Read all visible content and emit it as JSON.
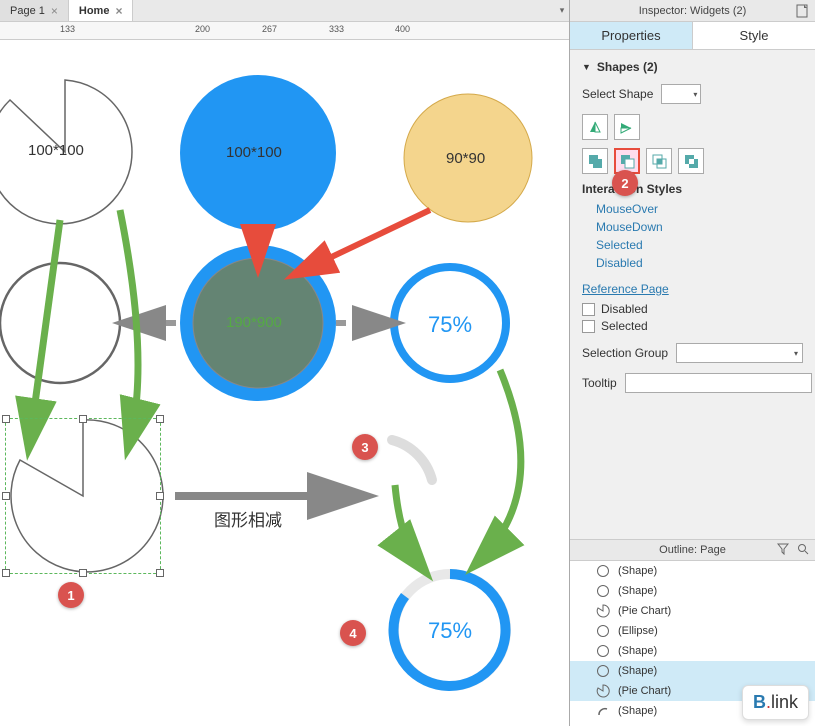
{
  "tabs": {
    "page1": "Page 1",
    "home": "Home"
  },
  "ruler": [
    "133",
    "200",
    "267",
    "333",
    "400"
  ],
  "canvas_labels": {
    "pie100": "100*100",
    "blue100": "100*100",
    "yellow90": "90*90",
    "green190": "190*900",
    "p75_1": "75%",
    "p75_2": "75%",
    "subtract_label": "图形相减"
  },
  "badges": {
    "b1": "1",
    "b2": "2",
    "b3": "3",
    "b4": "4"
  },
  "inspector": {
    "title": "Inspector: Widgets (2)",
    "tab_props": "Properties",
    "tab_style": "Style",
    "section": "Shapes (2)",
    "select_shape_label": "Select Shape",
    "interaction_heading": "Interaction Styles",
    "mouseover": "MouseOver",
    "mousedown": "MouseDown",
    "selected": "Selected",
    "disabled": "Disabled",
    "reference_page": "Reference Page",
    "chk_disabled": "Disabled",
    "chk_selected": "Selected",
    "selection_group": "Selection Group",
    "tooltip": "Tooltip"
  },
  "outline": {
    "title": "Outline: Page",
    "items": [
      {
        "icon": "circle",
        "label": "(Shape)"
      },
      {
        "icon": "circle",
        "label": "(Shape)"
      },
      {
        "icon": "pie",
        "label": "(Pie Chart)"
      },
      {
        "icon": "circle",
        "label": "(Ellipse)"
      },
      {
        "icon": "circle",
        "label": "(Shape)"
      },
      {
        "icon": "circle",
        "label": "(Shape)",
        "sel": true
      },
      {
        "icon": "pie",
        "label": "(Pie Chart)",
        "sel": true
      },
      {
        "icon": "arc",
        "label": "(Shape)"
      }
    ]
  },
  "blink": "Blink"
}
